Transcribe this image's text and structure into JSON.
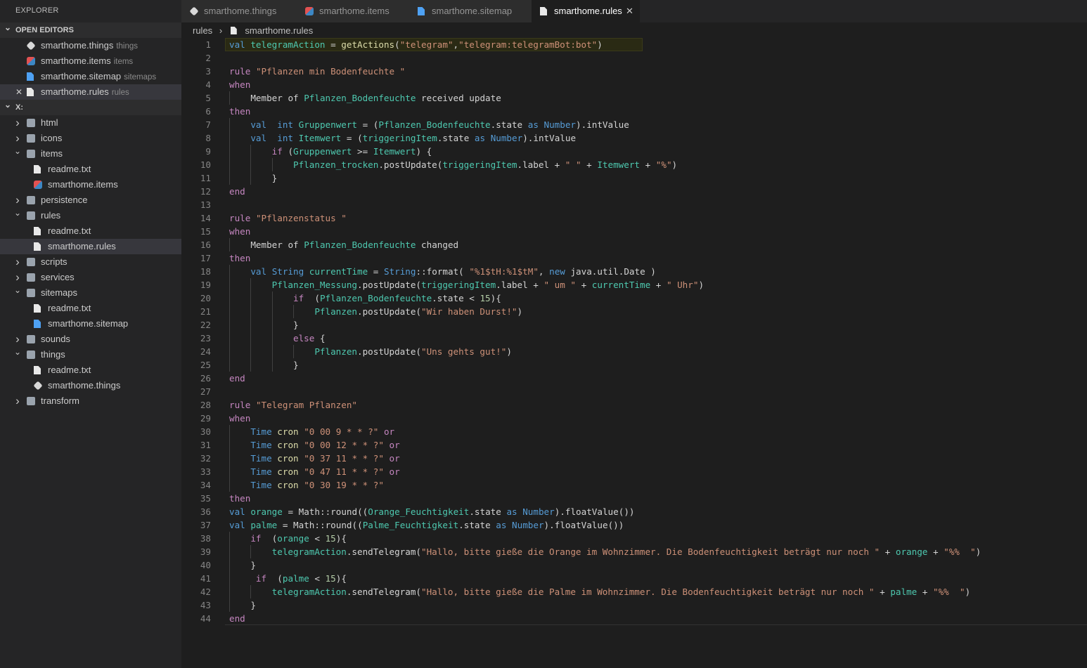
{
  "sidebar": {
    "title": "EXPLORER",
    "open_editors_label": "OPEN EDITORS",
    "open_editors": [
      {
        "name": "smarthome.things",
        "desc": "things",
        "icon": "things-cube-icon"
      },
      {
        "name": "smarthome.items",
        "desc": "items",
        "icon": "items-colored-icon"
      },
      {
        "name": "smarthome.sitemap",
        "desc": "sitemaps",
        "icon": "sitemap-file-icon"
      },
      {
        "name": "smarthome.rules",
        "desc": "rules",
        "icon": "rules-file-icon",
        "close": "✕"
      }
    ],
    "workspace_label": "X:",
    "tree": [
      {
        "name": "html",
        "type": "folder",
        "indent": 0,
        "expanded": false
      },
      {
        "name": "icons",
        "type": "folder",
        "indent": 0,
        "expanded": false
      },
      {
        "name": "items",
        "type": "folder",
        "indent": 0,
        "expanded": true
      },
      {
        "name": "readme.txt",
        "type": "file",
        "indent": 1
      },
      {
        "name": "smarthome.items",
        "type": "items",
        "indent": 1
      },
      {
        "name": "persistence",
        "type": "folder",
        "indent": 0,
        "expanded": false
      },
      {
        "name": "rules",
        "type": "folder",
        "indent": 0,
        "expanded": true
      },
      {
        "name": "readme.txt",
        "type": "file",
        "indent": 1
      },
      {
        "name": "smarthome.rules",
        "type": "file",
        "indent": 1,
        "selected": true
      },
      {
        "name": "scripts",
        "type": "folder",
        "indent": 0,
        "expanded": false
      },
      {
        "name": "services",
        "type": "folder",
        "indent": 0,
        "expanded": false
      },
      {
        "name": "sitemaps",
        "type": "folder",
        "indent": 0,
        "expanded": true
      },
      {
        "name": "readme.txt",
        "type": "file",
        "indent": 1
      },
      {
        "name": "smarthome.sitemap",
        "type": "sitemap",
        "indent": 1
      },
      {
        "name": "sounds",
        "type": "folder",
        "indent": 0,
        "expanded": false
      },
      {
        "name": "things",
        "type": "folder",
        "indent": 0,
        "expanded": true
      },
      {
        "name": "readme.txt",
        "type": "file",
        "indent": 1
      },
      {
        "name": "smarthome.things",
        "type": "things",
        "indent": 1
      },
      {
        "name": "transform",
        "type": "folder",
        "indent": 0,
        "expanded": false
      }
    ]
  },
  "tabs": [
    {
      "label": "smarthome.things",
      "icon": "things-cube-icon",
      "active": false
    },
    {
      "label": "smarthome.items",
      "icon": "items-colored-icon",
      "active": false
    },
    {
      "label": "smarthome.sitemap",
      "icon": "sitemap-file-icon",
      "active": false
    },
    {
      "label": "smarthome.rules",
      "icon": "rules-file-icon",
      "active": true,
      "close": "✕"
    }
  ],
  "breadcrumb": {
    "folder": "rules",
    "separator": "›",
    "file": "smarthome.rules"
  },
  "editor": {
    "highlighted_line": 1,
    "cursor_line": 44,
    "lines": [
      "val telegramAction = getActions(\"telegram\",\"telegram:telegramBot:bot\")",
      "",
      "rule \"Pflanzen min Bodenfeuchte \"",
      "when",
      "    Member of Pflanzen_Bodenfeuchte received update",
      "then",
      "    val  int Gruppenwert = (Pflanzen_Bodenfeuchte.state as Number).intValue",
      "    val  int Itemwert = (triggeringItem.state as Number).intValue",
      "        if (Gruppenwert >= Itemwert) {",
      "            Pflanzen_trocken.postUpdate(triggeringItem.label + \" \" + Itemwert + \"%\")",
      "        }",
      "end",
      "",
      "rule \"Pflanzenstatus \"",
      "when",
      "    Member of Pflanzen_Bodenfeuchte changed",
      "then",
      "    val String currentTime = String::format( \"%1$tH:%1$tM\", new java.util.Date )",
      "        Pflanzen_Messung.postUpdate(triggeringItem.label + \" um \" + currentTime + \" Uhr\")",
      "            if  (Pflanzen_Bodenfeuchte.state < 15){",
      "                Pflanzen.postUpdate(\"Wir haben Durst!\")",
      "            }",
      "            else {",
      "                Pflanzen.postUpdate(\"Uns gehts gut!\")",
      "            }",
      "end",
      "",
      "rule \"Telegram Pflanzen\"",
      "when",
      "    Time cron \"0 00 9 * * ?\" or",
      "    Time cron \"0 00 12 * * ?\" or",
      "    Time cron \"0 37 11 * * ?\" or",
      "    Time cron \"0 47 11 * * ?\" or",
      "    Time cron \"0 30 19 * * ?\"",
      "then",
      "val orange = Math::round((Orange_Feuchtigkeit.state as Number).floatValue())",
      "val palme = Math::round((Palme_Feuchtigkeit.state as Number).floatValue())",
      "    if  (orange < 15){",
      "        telegramAction.sendTelegram(\"Hallo, bitte gieße die Orange im Wohnzimmer. Die Bodenfeuchtigkeit beträgt nur noch \" + orange + \"%%  \")",
      "    }",
      "     if  (palme < 15){",
      "        telegramAction.sendTelegram(\"Hallo, bitte gieße die Palme im Wohnzimmer. Die Bodenfeuchtigkeit beträgt nur noch \" + palme + \"%%  \")",
      "    }",
      "end"
    ]
  }
}
